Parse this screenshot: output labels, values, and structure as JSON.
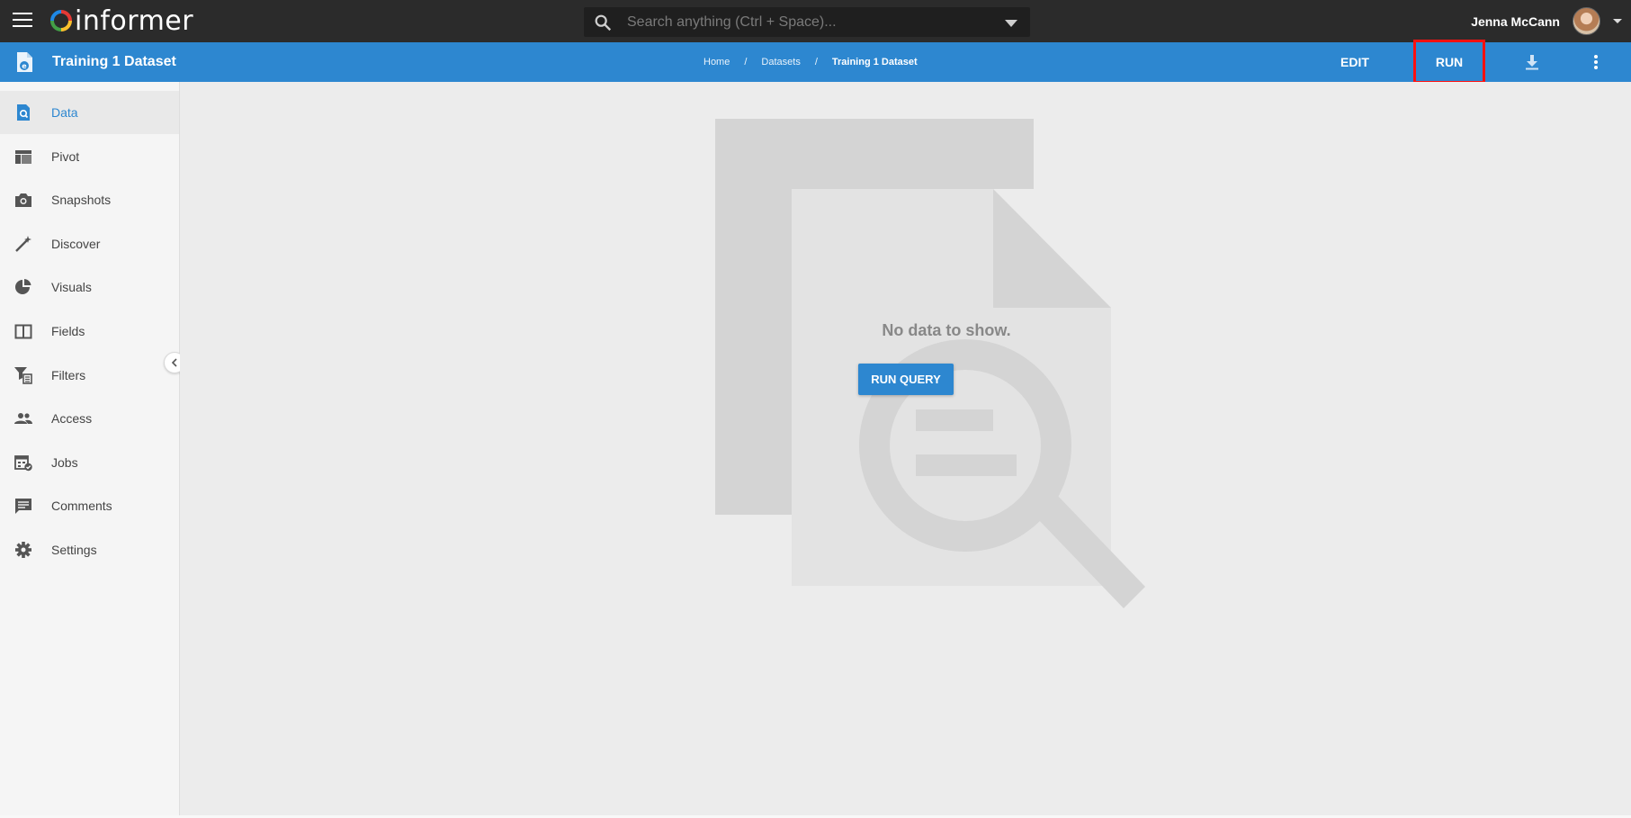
{
  "app": {
    "logo_text": "informer",
    "search_placeholder": "Search anything (Ctrl + Space)...",
    "user_name": "Jenna McCann"
  },
  "header": {
    "title": "Training 1 Dataset",
    "breadcrumb": [
      "Home",
      "Datasets",
      "Training 1 Dataset"
    ],
    "breadcrumb_sep": "/",
    "edit_label": "EDIT",
    "run_label": "RUN",
    "accent_color": "#2d87d0",
    "highlight_color": "#ff1010"
  },
  "sidebar": {
    "items": [
      {
        "label": "Data",
        "icon": "data-search-icon",
        "active": true
      },
      {
        "label": "Pivot",
        "icon": "pivot-table-icon"
      },
      {
        "label": "Snapshots",
        "icon": "camera-icon"
      },
      {
        "label": "Discover",
        "icon": "magic-wand-icon"
      },
      {
        "label": "Visuals",
        "icon": "pie-chart-icon"
      },
      {
        "label": "Fields",
        "icon": "columns-icon"
      },
      {
        "label": "Filters",
        "icon": "filter-icon"
      },
      {
        "label": "Access",
        "icon": "people-icon"
      },
      {
        "label": "Jobs",
        "icon": "calendar-check-icon"
      },
      {
        "label": "Comments",
        "icon": "comment-icon"
      },
      {
        "label": "Settings",
        "icon": "gear-icon"
      }
    ]
  },
  "main": {
    "empty_message": "No data to show.",
    "run_query_label": "RUN QUERY"
  }
}
